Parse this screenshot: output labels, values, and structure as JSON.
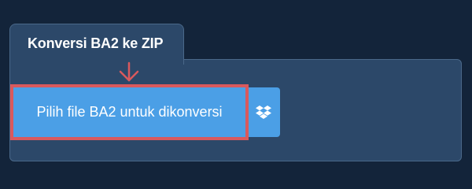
{
  "converter": {
    "tab_title": "Konversi BA2 ke ZIP",
    "upload_button_label": "Pilih file BA2 untuk dikonversi",
    "dropbox_icon": "dropbox-icon"
  },
  "annotation": {
    "arrow_icon": "arrow-down-icon",
    "highlight_color": "#d9595d"
  },
  "colors": {
    "background": "#13243a",
    "panel": "#2c4869",
    "button": "#4b9fe6",
    "text": "#ffffff"
  }
}
